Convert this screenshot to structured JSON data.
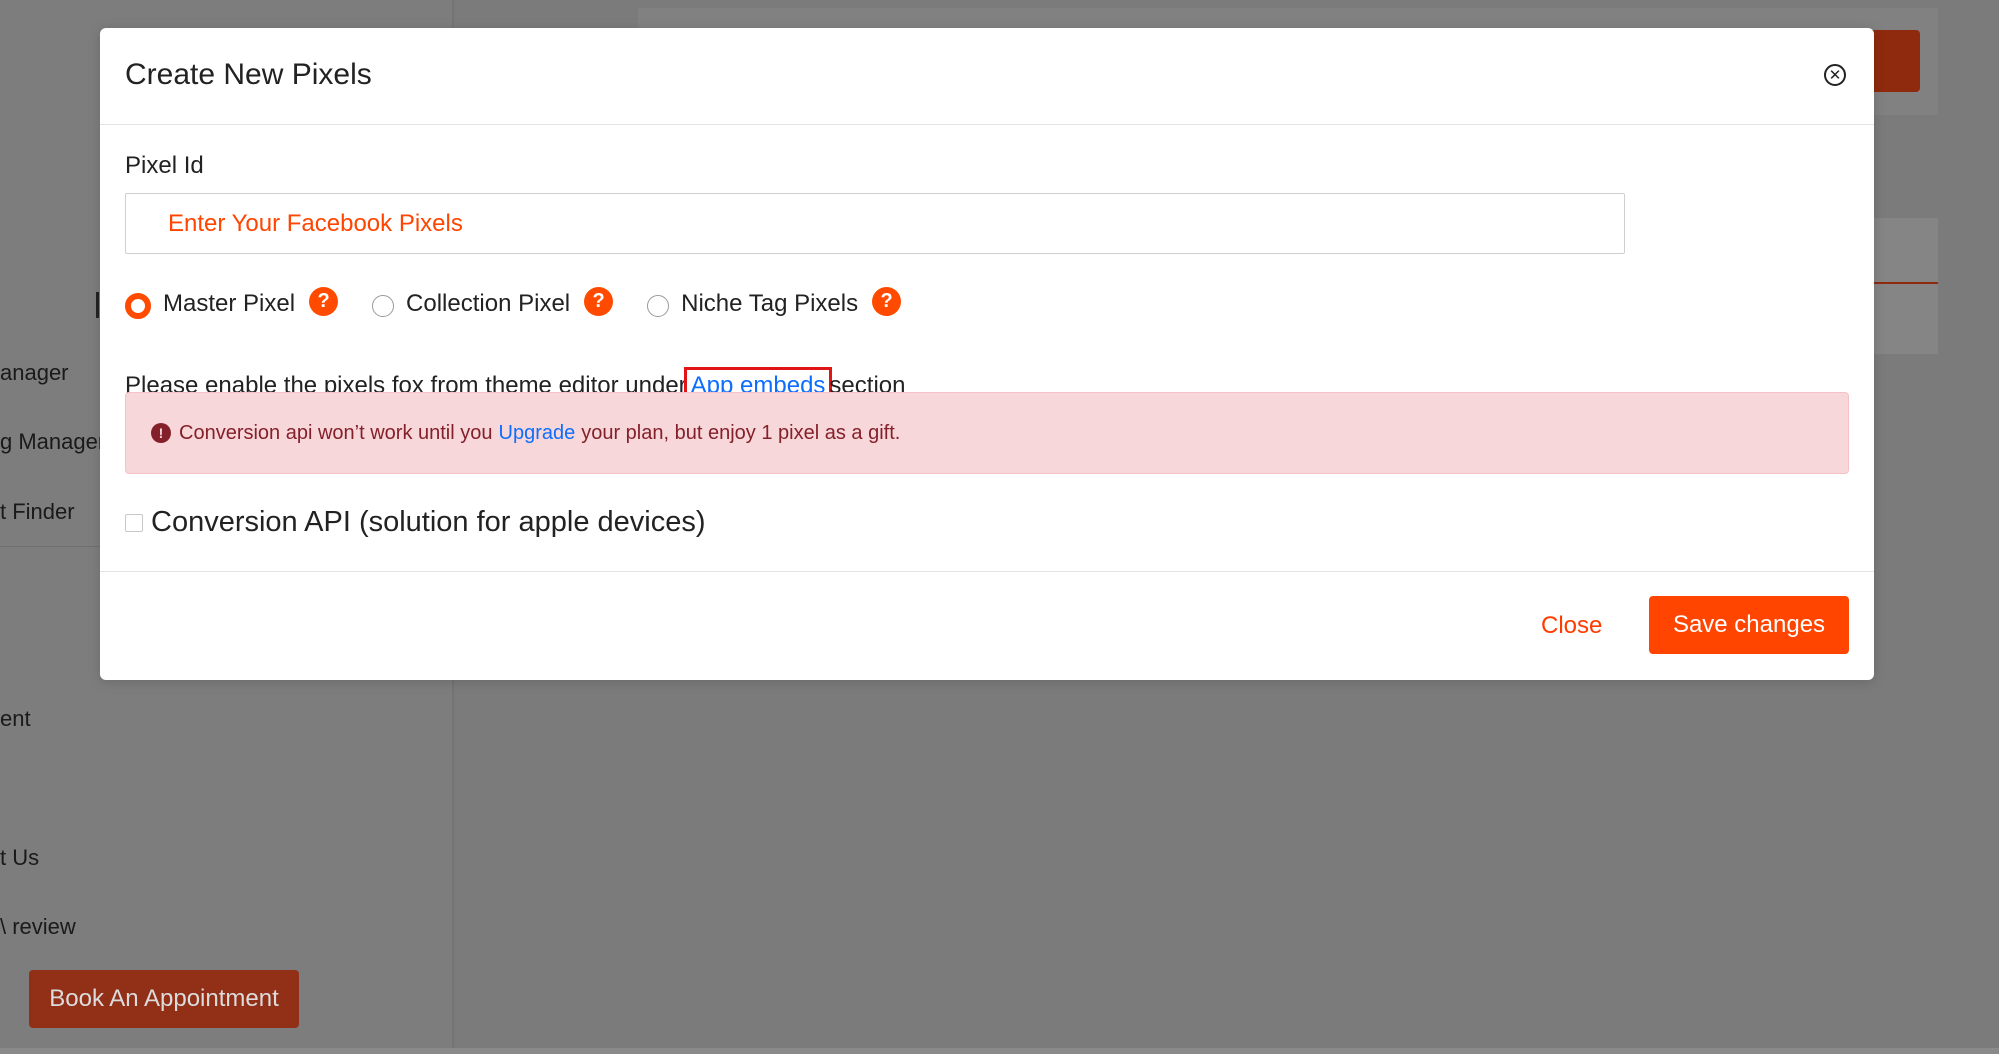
{
  "background": {
    "sidebar_items": [
      "anager",
      "g Manager",
      "t Finder",
      "ent",
      "t Us",
      "\\ review"
    ],
    "book_button": "Book An Appointment"
  },
  "modal": {
    "title": "Create New Pixels",
    "pixel_id_label": "Pixel Id",
    "pixel_input_placeholder": "Enter Your Facebook Pixels",
    "pixel_input_value": "",
    "radio_options": [
      {
        "label": "Master Pixel",
        "selected": true
      },
      {
        "label": "Collection Pixel",
        "selected": false
      },
      {
        "label": "Niche Tag Pixels",
        "selected": false
      }
    ],
    "help_glyph": "?",
    "info_prefix": "Please enable the pixels fox from theme editor under",
    "info_link": "App embeds",
    "info_suffix": "section",
    "alert": {
      "icon": "!",
      "prefix": "Conversion api won’t work until you",
      "link": "Upgrade",
      "suffix": "your plan, but enjoy 1 pixel as a gift."
    },
    "conversion_api_label": "Conversion API (solution for apple devices)",
    "conversion_api_checked": false,
    "close_button": "Close",
    "save_button": "Save changes"
  },
  "colors": {
    "accent": "#ff4500",
    "link": "#0d6efd",
    "alert_bg": "#f8d7da",
    "alert_text": "#842029",
    "highlight_box": "#e01515",
    "overlay": "#7b7b7b"
  },
  "icons": [
    "close-circle-icon",
    "help-icon",
    "exclamation-circle-icon"
  ]
}
